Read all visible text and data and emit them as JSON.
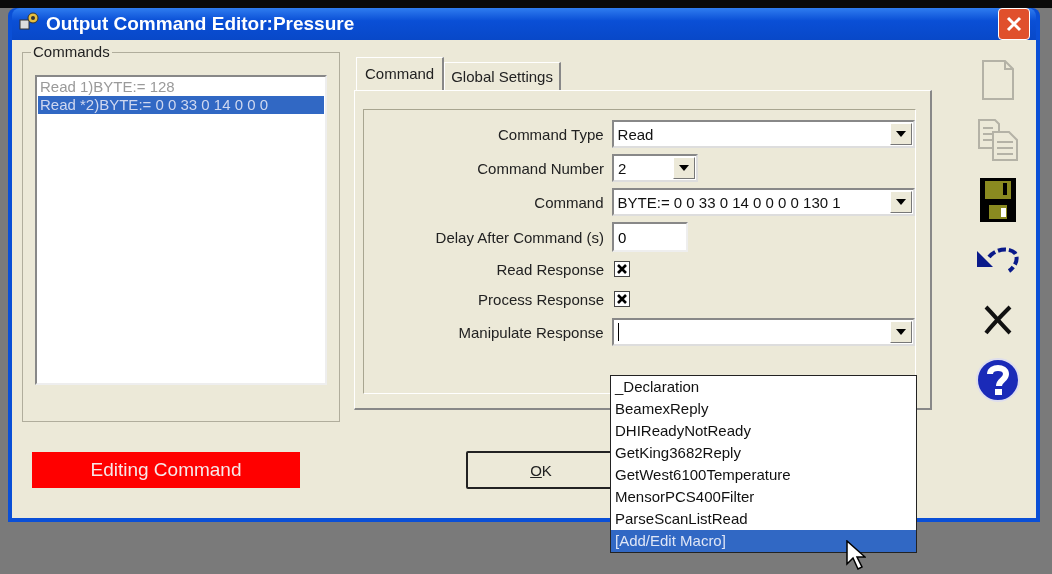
{
  "window": {
    "title": "Output Command Editor:Pressure"
  },
  "commands": {
    "label": "Commands",
    "items": [
      {
        "text": "Read 1)BYTE:= 128",
        "selected": false
      },
      {
        "text": "Read *2)BYTE:= 0 0 33 0 14 0 0 0",
        "selected": true
      }
    ]
  },
  "tabs": [
    {
      "label": "Command",
      "selected": true
    },
    {
      "label": "Global Settings",
      "selected": false
    }
  ],
  "form": {
    "rows": [
      {
        "kind": "combo",
        "label": "Command Type",
        "value": "Read"
      },
      {
        "kind": "short-combo",
        "label": "Command Number",
        "value": "2"
      },
      {
        "kind": "combo",
        "label": "Command",
        "value": "BYTE:= 0 0 33 0 14 0 0 0 0 130 1"
      },
      {
        "kind": "text",
        "label": "Delay After Command (s)",
        "value": "0"
      },
      {
        "kind": "checkbox",
        "label": "Read Response",
        "checked": true
      },
      {
        "kind": "checkbox",
        "label": "Process Response",
        "checked": true
      },
      {
        "kind": "combo",
        "label": "Manipulate Response",
        "expanded": true,
        "focused": true
      }
    ]
  },
  "dropdown": {
    "items": [
      {
        "text": "_Declaration",
        "selected": false
      },
      {
        "text": "BeamexReply",
        "selected": false
      },
      {
        "text": "DHIReadyNotReady",
        "selected": false
      },
      {
        "text": "GetKing3682Reply",
        "selected": false
      },
      {
        "text": "GetWest6100Temperature",
        "selected": false
      },
      {
        "text": "MensorPCS400Filter",
        "selected": false
      },
      {
        "text": "ParseScanListRead",
        "selected": false
      },
      {
        "text": "[Add/Edit Macro]",
        "selected": true
      }
    ]
  },
  "status": {
    "text": "Editing Command"
  },
  "buttons": [
    {
      "label": "OK"
    }
  ],
  "toolbar": [
    {
      "kind": "new",
      "disabled": true
    },
    {
      "kind": "copy",
      "disabled": true
    },
    {
      "kind": "save",
      "disabled": false
    },
    {
      "kind": "undo",
      "disabled": false
    },
    {
      "kind": "delete",
      "disabled": false
    },
    {
      "kind": "help",
      "disabled": false
    }
  ]
}
